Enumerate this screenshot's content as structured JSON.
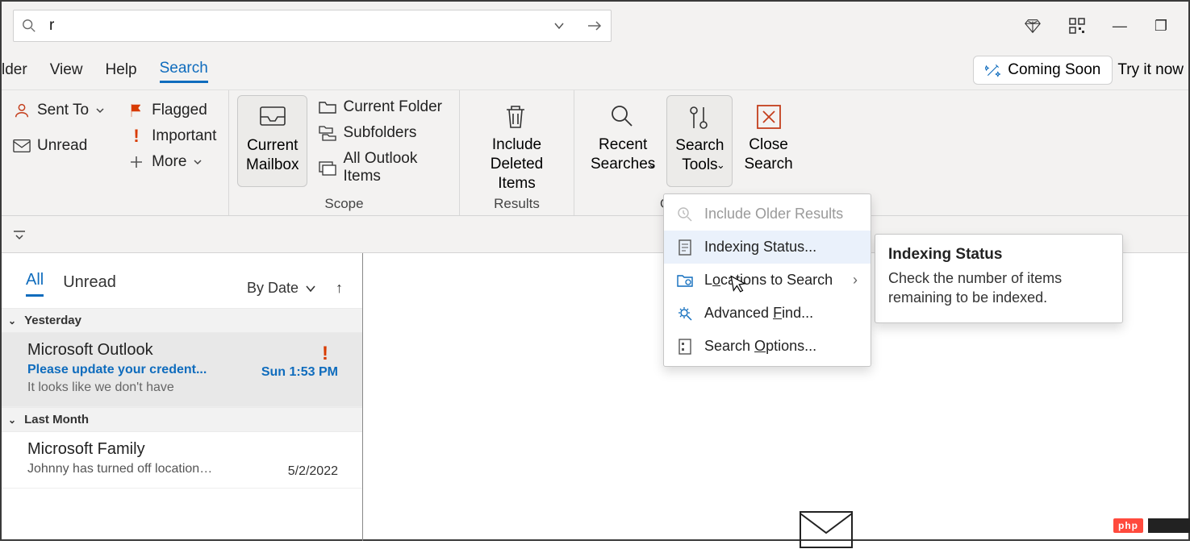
{
  "search": {
    "value": "r"
  },
  "window_controls": {
    "minimize": "—",
    "restore": "❐"
  },
  "menubar": {
    "tabs": [
      "lder",
      "View",
      "Help",
      "Search"
    ],
    "coming": "Coming Soon",
    "tryit": "Try it now"
  },
  "ribbon": {
    "refine": {
      "sent_to": "Sent To",
      "unread": "Unread",
      "flagged": "Flagged",
      "important": "Important",
      "more": "More"
    },
    "scope": {
      "current_mailbox": "Current\nMailbox",
      "current_folder": "Current Folder",
      "subfolders": "Subfolders",
      "all_items": "All Outlook Items",
      "label": "Scope"
    },
    "results": {
      "include_deleted": "Include\nDeleted Items",
      "label": "Results"
    },
    "options": {
      "recent": "Recent\nSearches",
      "tools": "Search\nTools",
      "close": "Close\nSearch",
      "label": "Option"
    }
  },
  "msglist": {
    "tabs": {
      "all": "All",
      "unread": "Unread"
    },
    "sort": "By Date",
    "groups": {
      "yesterday": "Yesterday",
      "last_month": "Last Month"
    },
    "items": [
      {
        "from": "Microsoft Outlook",
        "subject": "Please update your credent...",
        "date": "Sun 1:53 PM",
        "preview": "It looks like we don't have",
        "important": true
      },
      {
        "from": "Microsoft Family",
        "subject": "Johnny has turned off location ...",
        "date": "5/2/2022",
        "preview": "",
        "important": false
      }
    ]
  },
  "menu": {
    "include_older": "Include Older Results",
    "indexing": "Indexing Status...",
    "locations_pre": "L",
    "locations_u": "o",
    "locations_post": "cations to Search",
    "advfind_pre": "Advanced ",
    "advfind_u": "F",
    "advfind_post": "ind...",
    "opts_pre": "Search ",
    "opts_u": "O",
    "opts_post": "ptions..."
  },
  "tooltip": {
    "title": "Indexing Status",
    "body": "Check the number of items remaining to be indexed."
  },
  "badge": "php"
}
